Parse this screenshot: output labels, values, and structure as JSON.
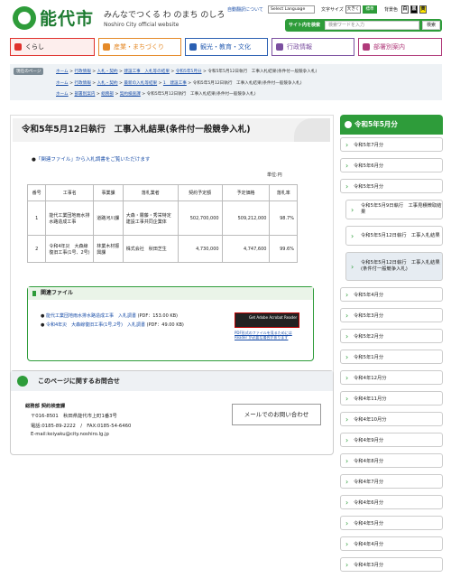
{
  "header": {
    "logo_text": "能代市",
    "catch": "みんなでつくる わ のまち のしろ",
    "sub": "Noshiro City official website",
    "auto_translate": "自動翻訳について",
    "language": "Select Language",
    "text_size_label": "文字サイズ",
    "size_large": "大きく",
    "size_std": "標準",
    "bg_label": "背景色",
    "bg_colors": [
      "白",
      "黒",
      "黄"
    ],
    "site_search_label": "サイト内を検索",
    "search_placeholder": "検索ワードを入力",
    "search_btn": "検索"
  },
  "gnav": [
    {
      "label": "くらし",
      "color": "#e0312c",
      "bg": "#fdeeed"
    },
    {
      "label": "産業・まちづくり",
      "color": "#e58a28",
      "bg": "#fff"
    },
    {
      "label": "観光・教育・文化",
      "color": "#2a5fb2",
      "bg": "#fff"
    },
    {
      "label": "行政情報",
      "color": "#7b4fa0",
      "bg": "#fff"
    },
    {
      "label": "部署別案内",
      "color": "#b03a7a",
      "bg": "#fff"
    }
  ],
  "breadcrumb": {
    "label": "現在のページ",
    "lines": [
      [
        "ホーム",
        "行政情報",
        "入札・契約",
        "建設工事　入札等の結果",
        "令和5年5月分"
      ],
      [
        "ホーム",
        "行政情報",
        "入札・契約",
        "最新の入札等結果",
        "1　建設工事"
      ],
      [
        "ホーム",
        "部署別案内",
        "総務部",
        "契約検査課"
      ]
    ],
    "currents": [
      "令和5年5月12日執行　工事入札結果(条件付一般競争入札)",
      "令和5年5月12日執行　工事入札結果(条件付一般競争入札)",
      "令和5年5月12日執行　工事入札結果(条件付一般競争入札)"
    ]
  },
  "main": {
    "title": "令和5年5月12日執行　工事入札結果(条件付一般競争入札)",
    "intro": "「関連ファイル」から入札調書をご覧いただけます",
    "unit": "単位:円",
    "table": {
      "headers": [
        "番号",
        "工事名",
        "事業課",
        "落札業者",
        "契約予定額",
        "予定価格",
        "落札率"
      ],
      "rows": [
        [
          "1",
          "能代工業団地雨水排水路造成工事",
          "道路河川課",
          "大森・霧藤・秀栄特定建設工事共同企業体",
          "502,700,000",
          "509,212,000",
          "98.7%"
        ],
        [
          "2",
          "令和4年災　大森線復旧工事(1号、2号)",
          "林業木材振興課",
          "株式会社　秋田芝生",
          "4,730,000",
          "4,747,600",
          "99.6%"
        ]
      ]
    },
    "related_title": "関連ファイル",
    "related": [
      {
        "text": "能代工業団地雨水排水路造成工事　入札調書",
        "size": "(PDF：153.00 KB)"
      },
      {
        "text": "令和4年災　大森線復旧工事(1号,2号)　入札調書",
        "size": "(PDF：49.00 KB)"
      }
    ],
    "acrobat": "Get Adobe Acrobat Reader",
    "acrobat_note": "PDF形式のファイルを見るためにはReader が必要な場合があります"
  },
  "inquiry": {
    "title": "このページに関するお問合せ",
    "dept": "総務部 契約検査課",
    "address": "〒016-8501　秋田県能代市上町1番3号",
    "phone": "電話:0185-89-2222　/　FAX:0185-54-6460",
    "email": "E-mail:keiyaku@city.noshiro.lg.jp",
    "mail_btn": "メールでのお問い合わせ"
  },
  "side": {
    "title": "令和5年5月分",
    "items": [
      {
        "label": "令和5年7月分",
        "sub": false
      },
      {
        "label": "令和5年6月分",
        "sub": false
      },
      {
        "label": "令和5年5月分",
        "sub": false
      },
      {
        "label": "令和5年5月9日執行　工事見積徴取結果",
        "sub": true
      },
      {
        "label": "令和5年5月12日執行　工事入札結果",
        "sub": true
      },
      {
        "label": "令和5年5月12日執行　工事入札結果(条件付一般競争入札)",
        "sub": true,
        "active": true
      },
      {
        "label": "令和5年4月分",
        "sub": false
      },
      {
        "label": "令和5年3月分",
        "sub": false
      },
      {
        "label": "令和5年2月分",
        "sub": false
      },
      {
        "label": "令和5年1月分",
        "sub": false
      },
      {
        "label": "令和4年12月分",
        "sub": false
      },
      {
        "label": "令和4年11月分",
        "sub": false
      },
      {
        "label": "令和4年10月分",
        "sub": false
      },
      {
        "label": "令和4年9月分",
        "sub": false
      },
      {
        "label": "令和4年8月分",
        "sub": false
      },
      {
        "label": "令和4年7月分",
        "sub": false
      },
      {
        "label": "令和4年6月分",
        "sub": false
      },
      {
        "label": "令和4年5月分",
        "sub": false
      },
      {
        "label": "令和4年4月分",
        "sub": false
      },
      {
        "label": "令和4年3月分",
        "sub": false
      }
    ]
  }
}
